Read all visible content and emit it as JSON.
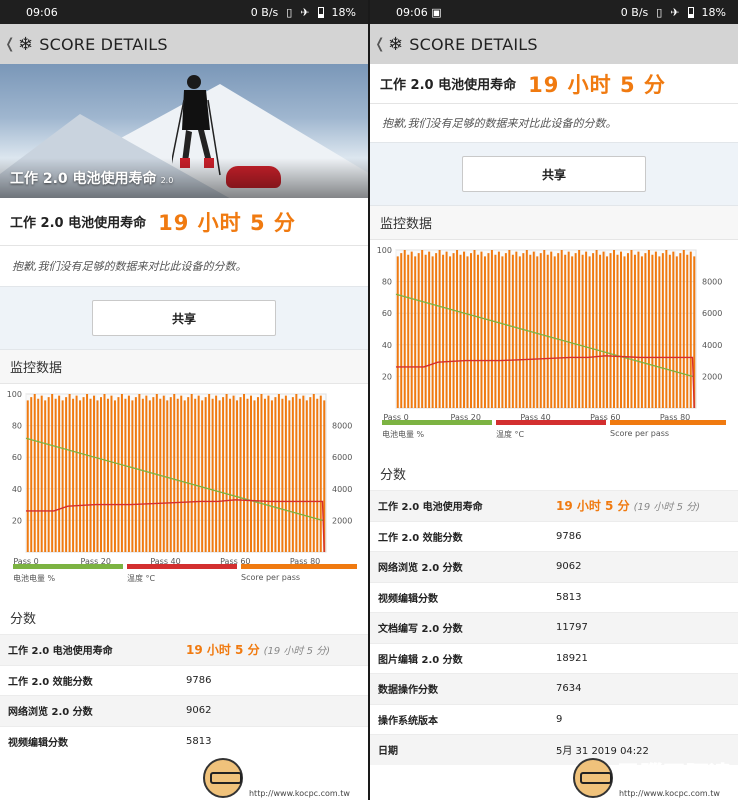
{
  "status": {
    "time": "09:06",
    "net": "0 B/s",
    "battery": "18%"
  },
  "appbar": {
    "title": "SCORE DETAILS"
  },
  "hero": {
    "caption": "工作 2.0 电池使用寿命",
    "version": "2.0"
  },
  "result": {
    "label": "工作 2.0 电池使用寿命",
    "value": "19 小时 5 分"
  },
  "sorry": "抱歉,我们没有足够的数据来对比此设备的分数。",
  "share_label": "共享",
  "monitor_title": "监控数据",
  "chart_data": {
    "type": "line",
    "x_ticks": [
      "Pass 0",
      "Pass 20",
      "Pass 40",
      "Pass 60",
      "Pass 80"
    ],
    "y_left_ticks": [
      "100",
      "80",
      "60",
      "40",
      "20"
    ],
    "y_right_ticks": [
      "8000",
      "6000",
      "4000",
      "2000"
    ],
    "ylim_left": [
      0,
      100
    ],
    "ylim_right": [
      0,
      10000
    ],
    "series": [
      {
        "name": "电池电量 %",
        "color": "#7cb342",
        "x": [
          0,
          85
        ],
        "values": [
          72,
          20
        ]
      },
      {
        "name": "温度 °C",
        "color": "#d32f2f",
        "x": [
          0,
          8,
          12,
          20,
          30,
          40,
          50,
          55,
          60,
          70,
          75,
          85,
          85.5
        ],
        "values": [
          26,
          26,
          29,
          30,
          30,
          31,
          32,
          32,
          33,
          32,
          32,
          32,
          0
        ]
      },
      {
        "name": "Score per pass",
        "color": "#f07a10",
        "bars": 86,
        "value_range": [
          9600,
          10000
        ]
      }
    ],
    "grid": true,
    "legend": "bottom"
  },
  "legend": [
    "电池电量 %",
    "温度 °C",
    "Score per pass"
  ],
  "scores_title": "分数",
  "scores": [
    {
      "k": "工作 2.0 电池使用寿命",
      "v": "19 小时 5 分",
      "sub": "(19 小时 5 分)"
    },
    {
      "k": "工作 2.0 效能分数",
      "v": "9786"
    },
    {
      "k": "网络浏览 2.0 分数",
      "v": "9062"
    },
    {
      "k": "视频编辑分数",
      "v": "5813"
    },
    {
      "k": "文档编写 2.0 分数",
      "v": "11797"
    },
    {
      "k": "图片编辑 2.0 分数",
      "v": "18921"
    },
    {
      "k": "数据操作分数",
      "v": "7634"
    },
    {
      "k": "操作系统版本",
      "v": "9"
    },
    {
      "k": "日期",
      "v": "5月 31 2019 04:22"
    }
  ],
  "watermark": {
    "text": "電腦王阿達",
    "url": "http://www.kocpc.com.tw"
  }
}
